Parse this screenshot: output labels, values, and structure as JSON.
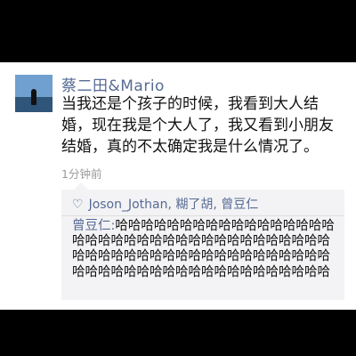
{
  "post": {
    "author": "蔡二田&Mario",
    "text": "当我还是个孩子的时候，我看到大人结婚，现在我是个大人了，我又看到小朋友结婚，真的不太确定我是什么情况了。",
    "time": "1分钟前"
  },
  "likes": {
    "icon": "heart-outline-icon",
    "names": "Joson_Jothan, 糊了胡, 曾豆仁"
  },
  "comment": {
    "author": "曾豆仁:",
    "text": "哈哈哈哈哈哈哈哈哈哈哈哈哈哈哈哈哈哈哈哈哈哈哈哈哈哈哈哈哈哈哈哈哈哈哈哈哈哈哈哈哈哈哈哈哈哈哈哈哈哈哈哈哈哈哈哈哈哈哈哈哈哈哈哈哈哈哈哈哈哈哈哈哈哈哈哈哈"
  },
  "colors": {
    "link": "#576b95",
    "background": "#000000",
    "card": "#ffffff",
    "comment_bg": "#f3f3f5"
  }
}
